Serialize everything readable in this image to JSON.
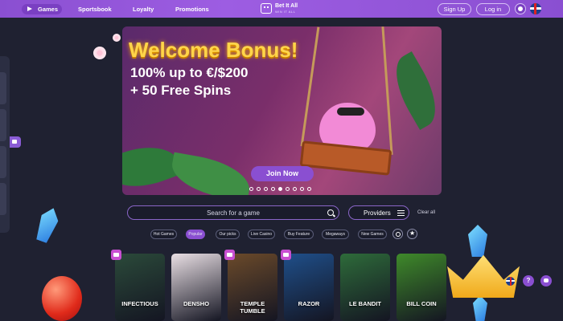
{
  "nav": {
    "games": "Games",
    "sportsbook": "Sportsbook",
    "loyalty": "Loyalty",
    "promotions": "Promotions"
  },
  "brand": {
    "name": "Bet It All",
    "tagline": "WIN IT ALL"
  },
  "account": {
    "signup": "Sign Up",
    "login": "Log in"
  },
  "banner": {
    "title": "Welcome Bonus!",
    "line1": "100% up to €/$200",
    "line2": "+ 50 Free Spins",
    "cta": "Join Now",
    "slide_count": 9,
    "active_slide": 4
  },
  "search": {
    "placeholder": "Search for a game"
  },
  "filters": {
    "providers_label": "Providers",
    "clear_label": "Clear all",
    "chips": [
      "Hot Games",
      "Popular",
      "Our picks",
      "Live Casino",
      "Buy Feature",
      "Megaways",
      "New Games"
    ],
    "active_chip": "Popular"
  },
  "games": [
    {
      "title": "INFECTIOUS",
      "bg": "#2b4a3a"
    },
    {
      "title": "DENSHO",
      "bg": "#e9dfe4"
    },
    {
      "title": "TEMPLE TUMBLE",
      "bg": "#6b4a2a"
    },
    {
      "title": "RAZOR",
      "bg": "#1f4f8a"
    },
    {
      "title": "LE BANDIT",
      "bg": "#2e6b3a"
    },
    {
      "title": "BILL COIN",
      "bg": "#3f8a2a"
    }
  ],
  "help": {
    "label": "?"
  },
  "colors": {
    "accent": "#8a4fd1",
    "background": "#1f2131",
    "banner_title": "#ffd54a"
  }
}
